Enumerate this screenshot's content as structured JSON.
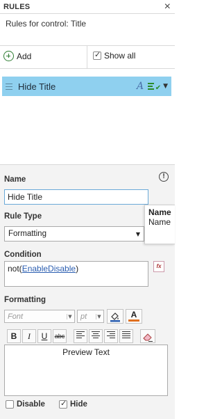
{
  "panel": {
    "title": "RULES",
    "close": "×"
  },
  "subtitle": "Rules for control: Title",
  "toolbar": {
    "add_label": "Add",
    "show_all_label": "Show all",
    "show_all_checked": true
  },
  "rules": [
    {
      "label": "Hide Title",
      "icon_a": "A"
    }
  ],
  "props": {
    "name_label": "Name",
    "name_value": "Hide Title",
    "info_glyph": "!",
    "rule_type_label": "Rule Type",
    "rule_type_value": "Formatting",
    "condition_label": "Condition",
    "condition": {
      "prefix": "not(",
      "link": "EnableDisable",
      "suffix": ")"
    },
    "fx_label": "fx",
    "formatting_label": "Formatting",
    "font_placeholder": "Font",
    "size_placeholder": "pt",
    "text_color_label": "A",
    "bold": "B",
    "italic": "I",
    "underline": "U",
    "strike": "abc",
    "preview_text": "Preview Text",
    "disable_label": "Disable",
    "disable_checked": false,
    "hide_label": "Hide",
    "hide_checked": true
  },
  "tooltip": {
    "line1": "Name",
    "line2": "Name"
  },
  "colors": {
    "rule_selected": "#8fd0ef",
    "link": "#2a5db0",
    "add_green": "#2e7d32",
    "panel_bg": "#f3f3f3"
  }
}
